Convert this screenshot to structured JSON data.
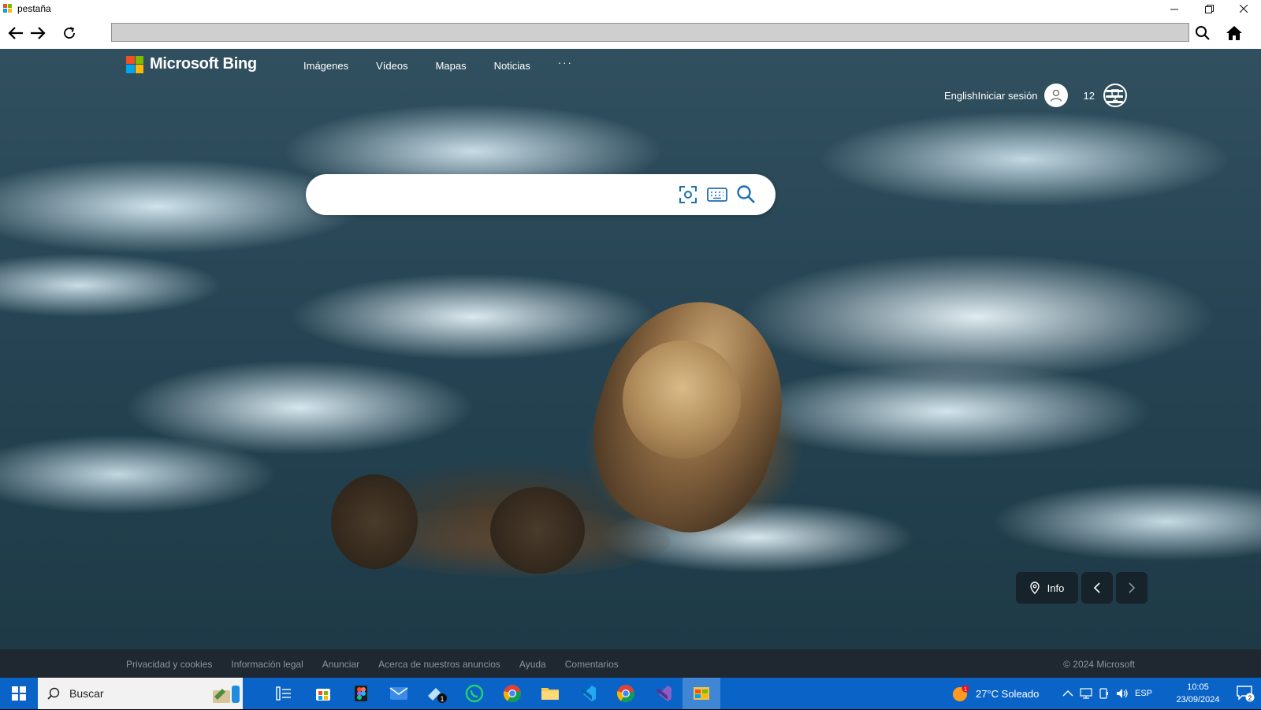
{
  "window": {
    "tab_title": "pestaña"
  },
  "bing": {
    "brand": "Microsoft Bing",
    "nav": [
      "Imágenes",
      "Vídeos",
      "Mapas",
      "Noticias"
    ],
    "nav_more": "···",
    "lang": "English",
    "signin": "Iniciar sesión",
    "points": "12",
    "search": {
      "placeholder": "",
      "value": ""
    },
    "info_label": "Info"
  },
  "footer": {
    "links": [
      "Privacidad y cookies",
      "Información legal",
      "Anunciar",
      "Acerca de nuestros anuncios",
      "Ayuda",
      "Comentarios"
    ],
    "copyright": "© 2024 Microsoft"
  },
  "taskbar": {
    "search_label": "Buscar",
    "weather": "27°C  Soleado",
    "weather_badge": "1",
    "lang": "ESP",
    "time": "10:05",
    "date": "23/09/2024",
    "notif_count": "2",
    "mail_badge": "1"
  },
  "colors": {
    "taskbar": "#0a64c8",
    "footer": "#1f2830",
    "ms_red": "#f25022",
    "ms_green": "#7fba00",
    "ms_blue": "#00a4ef",
    "ms_yellow": "#ffb900"
  }
}
